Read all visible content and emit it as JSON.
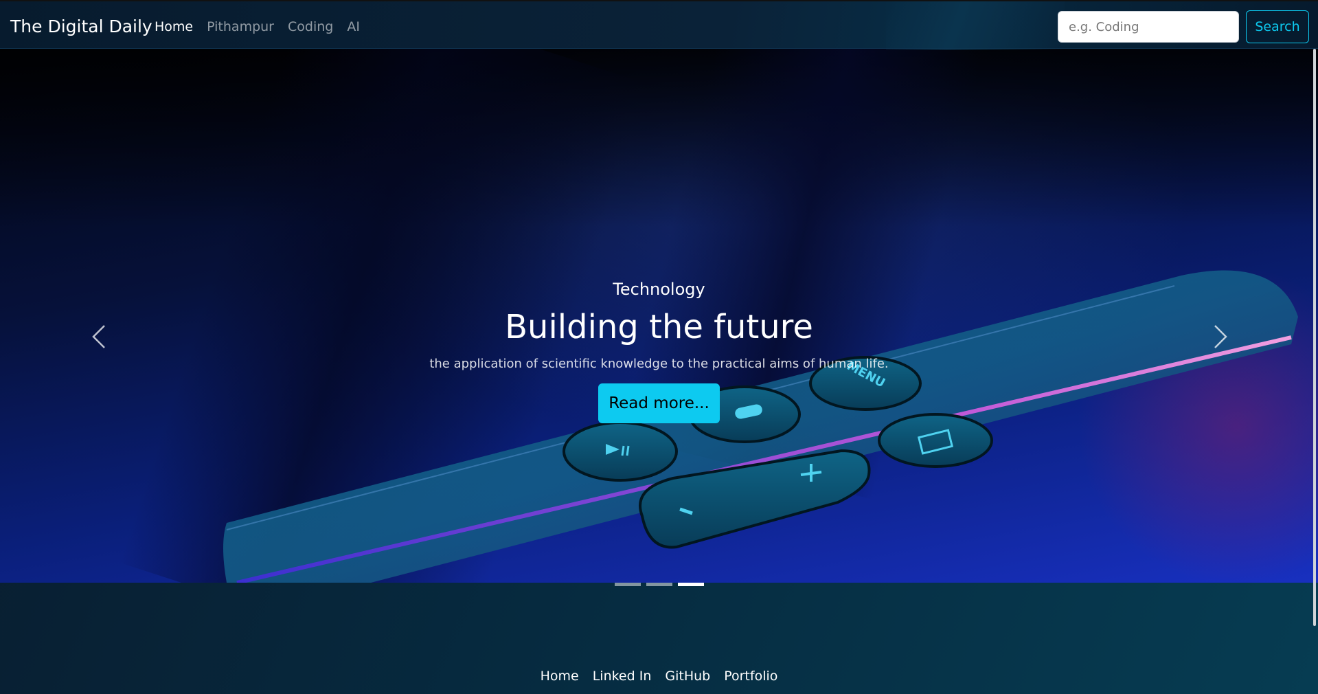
{
  "navbar": {
    "brand": "The Digital Daily",
    "links": [
      "Home",
      "Pithampur",
      "Coding",
      "AI"
    ],
    "active_link": "Home",
    "search_placeholder": "e.g. Coding",
    "search_button": "Search"
  },
  "carousel": {
    "kicker": "Technology",
    "title": "Building the future",
    "description": "the application of scientific knowledge to the practical aims of human life.",
    "read_more": "Read more...",
    "slide_count": 3,
    "active_slide": 3,
    "remote_labels": {
      "menu": "MENU"
    }
  },
  "footer": {
    "links": [
      "Home",
      "Linked In",
      "GitHub",
      "Portfolio"
    ]
  },
  "colors": {
    "accent": "#0dcaf0",
    "nav_background": "#0a2238",
    "page_background": "#063c52"
  },
  "icons": {
    "prev": "chevron-left-icon",
    "next": "chevron-right-icon"
  }
}
